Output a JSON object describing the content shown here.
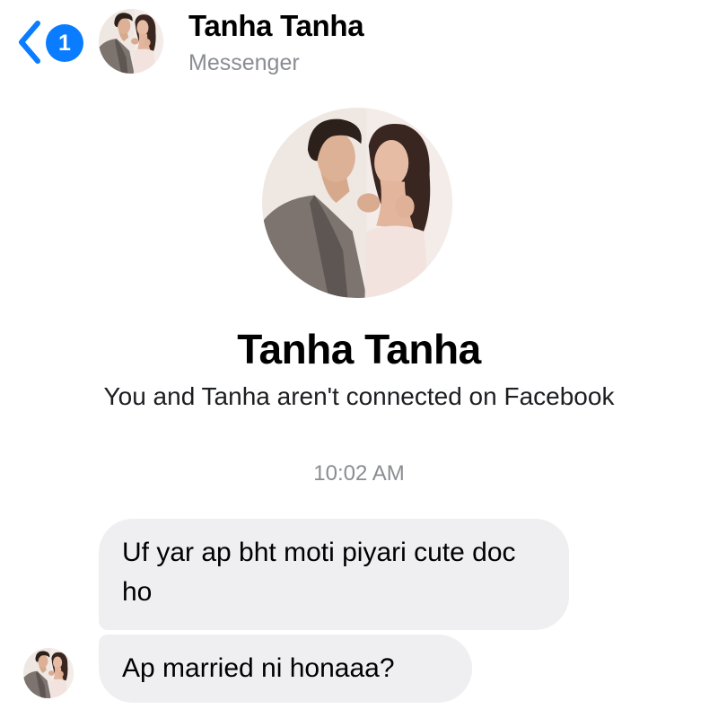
{
  "header": {
    "back_label": "Back",
    "unread_count": "1",
    "contact_name": "Tanha Tanha",
    "subtitle": "Messenger"
  },
  "profile": {
    "name": "Tanha Tanha",
    "status": "You and Tanha aren't connected on Facebook"
  },
  "thread": {
    "timestamp": "10:02 AM",
    "messages": [
      {
        "sender": "Tanha Tanha",
        "text": "Uf yar ap bht moti piyari cute doc ho"
      },
      {
        "sender": "Tanha Tanha",
        "text": "Ap married ni honaaa?"
      }
    ]
  },
  "colors": {
    "accent": "#0a7cff",
    "bubble_bg": "#efeff1",
    "secondary_text": "#8a8d91"
  },
  "icons": {
    "back": "chevron-left-icon",
    "avatar": "profile-photo-couple"
  }
}
